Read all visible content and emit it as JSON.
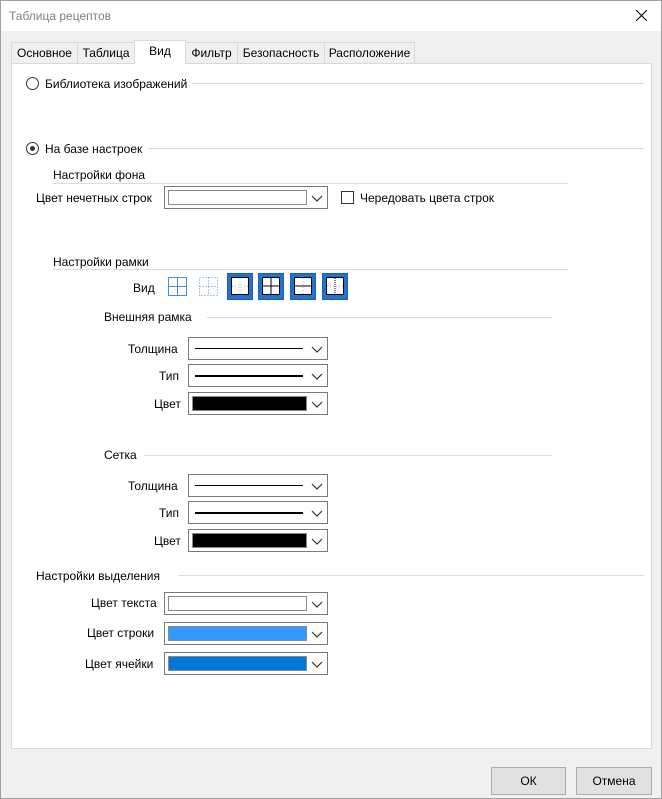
{
  "window": {
    "title": "Таблица рецептов"
  },
  "tabs": [
    {
      "label": "Основное"
    },
    {
      "label": "Таблица"
    },
    {
      "label": "Вид"
    },
    {
      "label": "Фильтр"
    },
    {
      "label": "Безопасность"
    },
    {
      "label": "Расположение"
    }
  ],
  "active_tab": "Вид",
  "source": {
    "image_library": {
      "label": "Библиотека изображений",
      "selected": false
    },
    "settings_based": {
      "label": "На базе настроек",
      "selected": true
    }
  },
  "background": {
    "section_title": "Настройки фона",
    "odd_rows_label": "Цвет нечетных строк",
    "odd_rows_color": "#ffffff",
    "alternate_label": "Чередовать цвета строк",
    "alternate_checked": false
  },
  "frame": {
    "section_title": "Настройки рамки",
    "view_label": "Вид",
    "view_icons": [
      "all-borders-icon",
      "inner-dotted-borders-icon",
      "outer-border-icon",
      "outer-and-inner-borders-icon",
      "outer-and-horizontal-borders-icon",
      "outer-dotted-borders-icon"
    ],
    "outer": {
      "title": "Внешняя рамка",
      "thickness_label": "Толщина",
      "type_label": "Тип",
      "color_label": "Цвет",
      "color": "#000000"
    },
    "grid": {
      "title": "Сетка",
      "thickness_label": "Толщина",
      "type_label": "Тип",
      "color_label": "Цвет",
      "color": "#000000"
    }
  },
  "selection": {
    "section_title": "Настройки выделения",
    "text_color_label": "Цвет текста",
    "text_color": "#ffffff",
    "row_color_label": "Цвет строки",
    "row_color": "#3399ff",
    "cell_color_label": "Цвет ячейки",
    "cell_color": "#0078d7"
  },
  "buttons": {
    "ok": "ОК",
    "cancel": "Отмена"
  }
}
